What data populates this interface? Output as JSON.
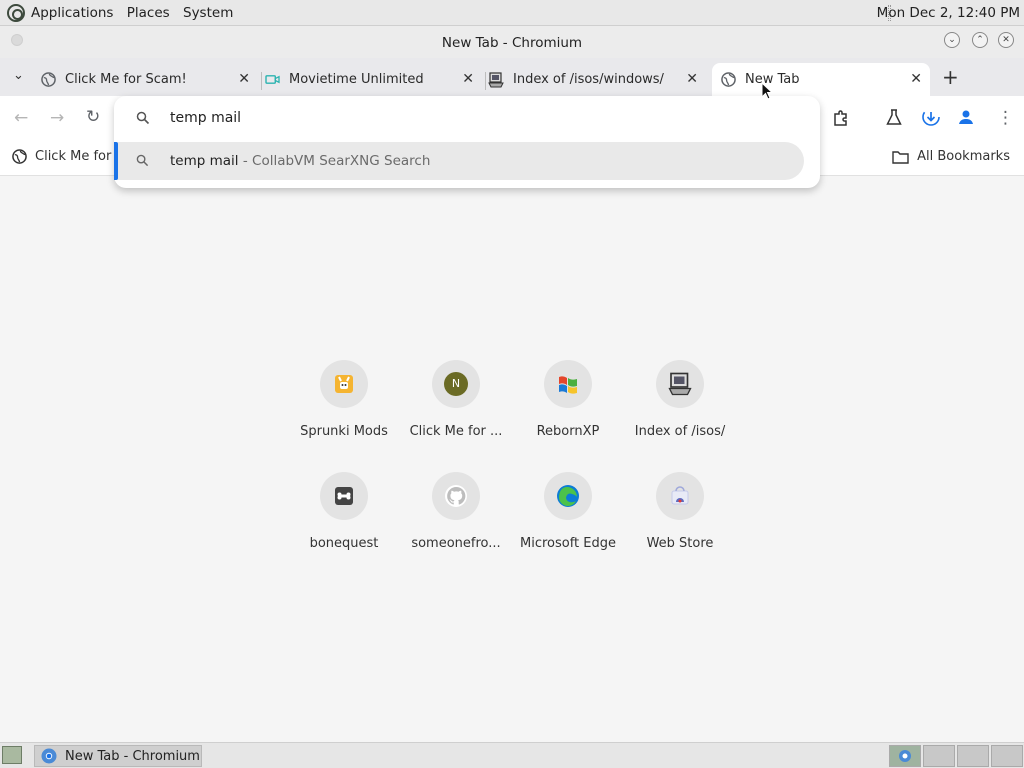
{
  "top_panel": {
    "menus": [
      "Applications",
      "Places",
      "System"
    ],
    "clock": "Mon Dec  2, 12:40 PM"
  },
  "window": {
    "title": "New Tab - Chromium"
  },
  "tabs": [
    {
      "label": "Click Me for Scam!",
      "icon": "globe-icon"
    },
    {
      "label": "Movietime Unlimited",
      "icon": "film-icon"
    },
    {
      "label": "Index of /isos/windows/",
      "icon": "computer-icon"
    },
    {
      "label": "New Tab",
      "icon": "globe-icon",
      "active": true
    }
  ],
  "omnibox": {
    "input_value": "temp mail",
    "suggestion": {
      "query": "temp mail",
      "separator": " - ",
      "description": "CollabVM SearXNG Search"
    }
  },
  "bookmarks": {
    "item": "Click Me for Sc",
    "all_bookmarks": "All Bookmarks"
  },
  "shortcuts": [
    {
      "label": "Sprunki Mods",
      "icon": "sprunki-icon"
    },
    {
      "label": "Click Me for ...",
      "icon": "letter-n-icon",
      "letter": "N"
    },
    {
      "label": "RebornXP",
      "icon": "windows-xp-icon"
    },
    {
      "label": "Index of /isos/",
      "icon": "computer-icon"
    },
    {
      "label": "bonequest",
      "icon": "bone-icon"
    },
    {
      "label": "someonefro...",
      "icon": "github-icon"
    },
    {
      "label": "Microsoft Edge",
      "icon": "edge-icon"
    },
    {
      "label": "Web Store",
      "icon": "web-store-icon"
    }
  ],
  "taskbar": {
    "window_button": "New Tab - Chromium"
  },
  "colors": {
    "accent": "#1a73e8",
    "edge_blue": "#0c7cd5",
    "edge_green": "#4cc24a",
    "sprunki_orange": "#f5b431",
    "n_olive": "#6b6b25"
  }
}
